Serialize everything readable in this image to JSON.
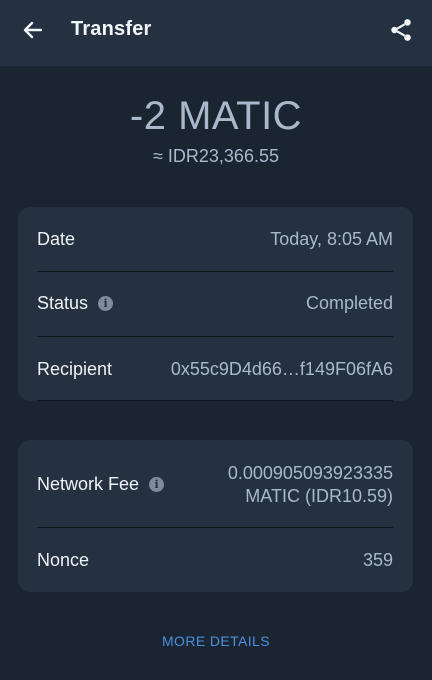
{
  "header": {
    "title": "Transfer"
  },
  "summary": {
    "amount": "-2 MATIC",
    "fiat": "≈ IDR23,366.55"
  },
  "details": {
    "date_label": "Date",
    "date_value": "Today, 8:05 AM",
    "status_label": "Status",
    "status_value": "Completed",
    "recipient_label": "Recipient",
    "recipient_value": "0x55c9D4d66…f149F06fA6"
  },
  "fees": {
    "network_fee_label": "Network Fee",
    "network_fee_line1": "0.000905093923335",
    "network_fee_line2": "MATIC (IDR10.59)",
    "nonce_label": "Nonce",
    "nonce_value": "359"
  },
  "footer": {
    "more_details": "MORE DETAILS"
  },
  "icons": {
    "back": "arrow-left-icon",
    "share": "share-icon",
    "info": "info-icon"
  },
  "colors": {
    "background": "#1b2431",
    "card": "#253140",
    "accent": "#4a8fe0"
  }
}
